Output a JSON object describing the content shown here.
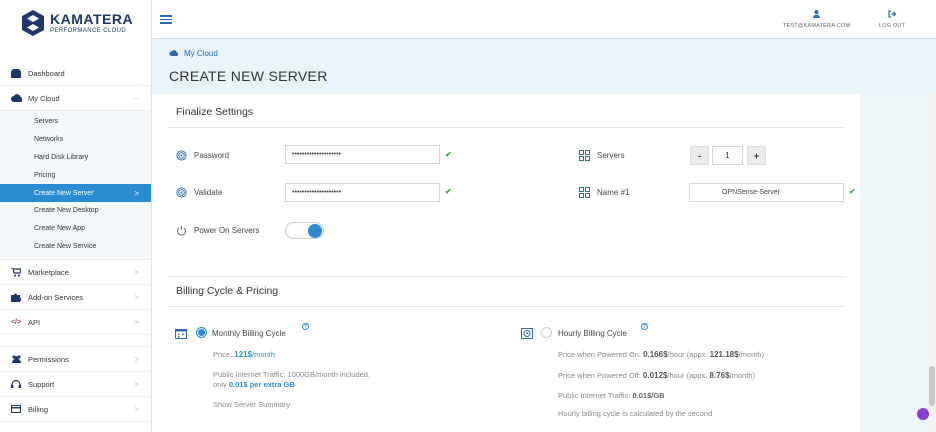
{
  "brand": {
    "name": "KAMATERA",
    "sub": "PERFORMANCE CLOUD",
    "color": "#1e3768"
  },
  "topbar": {
    "user_label": "TEST@KAMATERA.COM",
    "logout_label": "LOG OUT",
    "user_icon": "user-icon",
    "logout_icon": "logout-icon"
  },
  "sidebar": {
    "items": [
      {
        "label": "Dashboard",
        "icon": "dashboard-icon"
      },
      {
        "label": "My Cloud",
        "icon": "cloud-icon"
      },
      {
        "label": "Marketplace",
        "icon": "cart-icon"
      },
      {
        "label": "Add-on Services",
        "icon": "puzzle-icon"
      },
      {
        "label": "API",
        "icon": "code-icon"
      },
      {
        "label": "Permissions",
        "icon": "users-icon"
      },
      {
        "label": "Support",
        "icon": "headset-icon"
      },
      {
        "label": "Billing",
        "icon": "billing-icon"
      }
    ],
    "my_cloud_sub": [
      {
        "label": "Servers"
      },
      {
        "label": "Networks"
      },
      {
        "label": "Hard Disk Library"
      },
      {
        "label": "Pricing"
      },
      {
        "label": "Create New Server",
        "active": true
      },
      {
        "label": "Create New Desktop"
      },
      {
        "label": "Create New App"
      },
      {
        "label": "Create New Service"
      }
    ],
    "accent": "#2b8cd1"
  },
  "header": {
    "breadcrumb": "My Cloud",
    "title": "CREATE NEW SERVER"
  },
  "finalize": {
    "title": "Finalize Settings",
    "password_label": "Password",
    "password_value": "••••••••••••••••••••",
    "validate_label": "Validate",
    "validate_value": "••••••••••••••••••••",
    "power_label": "Power On Servers",
    "power_on": true,
    "servers_label": "Servers",
    "servers_minus": "-",
    "servers_value": "1",
    "servers_plus": "+",
    "name_label": "Name #1",
    "name_value": "OPNSense-Server"
  },
  "billing": {
    "title": "Billing Cycle & Pricing",
    "monthly": {
      "label": "Monthly Billing Cycle",
      "selected": true,
      "price_label": "Price:",
      "price_value": "121$",
      "price_unit": "/month",
      "traffic_line1": "Public Internet Traffic: 1000GB/month included,",
      "traffic_prefix": "only",
      "traffic_value": "0.01$ per extra GB",
      "summary_link": "Show Server Summary"
    },
    "hourly": {
      "label": "Hourly Billing Cycle",
      "selected": false,
      "on_label": "Price when Powered On:",
      "on_value": "0.166$",
      "on_unit": "/hour (appx.",
      "on_month": "121.18$",
      "on_month_unit": "/month)",
      "off_label": "Price when Powered Off:",
      "off_value": "0.012$",
      "off_unit": "/hour (appx.",
      "off_month": "8.76$",
      "off_month_unit": "/month)",
      "traffic_label": "Public Internet Traffic:",
      "traffic_value": "0.01$/GB",
      "note": "Hourly billing cycle is calculated by the second"
    }
  }
}
